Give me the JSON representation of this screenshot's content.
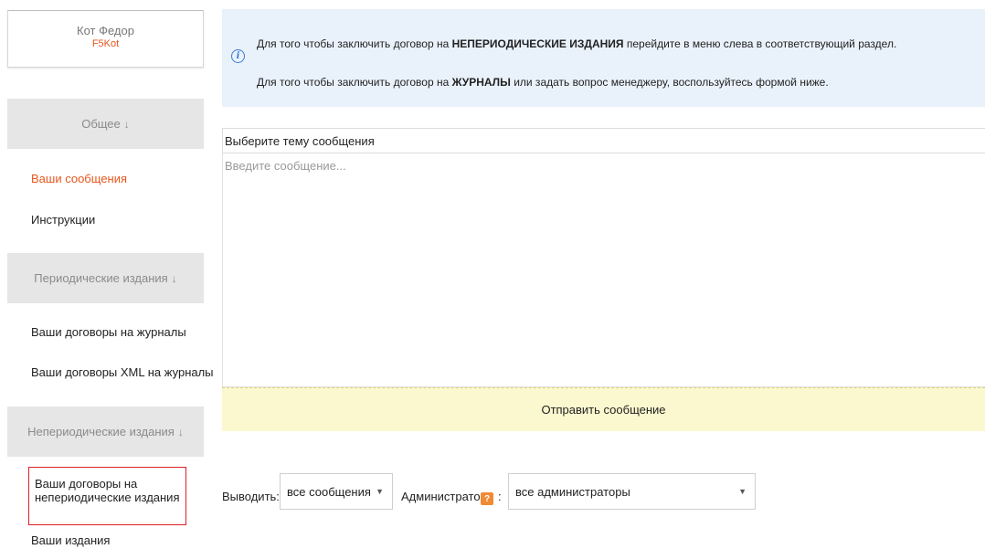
{
  "user": {
    "name": "Кот Федор",
    "login": "F5Kot"
  },
  "sidebar": {
    "sections": [
      {
        "title": "Общее",
        "arrow": "↓",
        "items": [
          "Ваши сообщения",
          "Инструкции"
        ]
      },
      {
        "title": "Периодические издания",
        "arrow": "↓",
        "items": [
          "Ваши договоры на журналы",
          "Ваши договоры XML на журналы"
        ]
      },
      {
        "title": "Непериодические издания",
        "arrow": "↓",
        "items": [
          "Ваши договоры на непериодические издания",
          "Ваши издания"
        ]
      }
    ],
    "active_item": "Ваши сообщения"
  },
  "info": {
    "line1": {
      "pre": "Для того чтобы заключить договор на ",
      "bold": "НЕПЕРИОДИЧЕСКИЕ ИЗДАНИЯ",
      "post": " перейдите в меню слева в соответствующий раздел."
    },
    "line2": {
      "pre": "Для того чтобы заключить договор на ",
      "bold": "ЖУРНАЛЫ",
      "post": " или задать вопрос менеджеру, воспользуйтесь формой ниже."
    }
  },
  "form": {
    "topic_placeholder": "Выберите тему сообщения",
    "message_placeholder": "Введите сообщение...",
    "send_label": "Отправить сообщение"
  },
  "filters": {
    "show_label": "Выводить:",
    "show_value": "все сообщения",
    "admin_label": "Администратор",
    "admin_help": "?",
    "admin_colon": ":",
    "admin_value": "все администраторы"
  },
  "colors": {
    "accent": "#e8571e",
    "info_bg": "#e9f2fb",
    "send_bg": "#fbf8cf",
    "section_bg": "#e6e6e6"
  }
}
